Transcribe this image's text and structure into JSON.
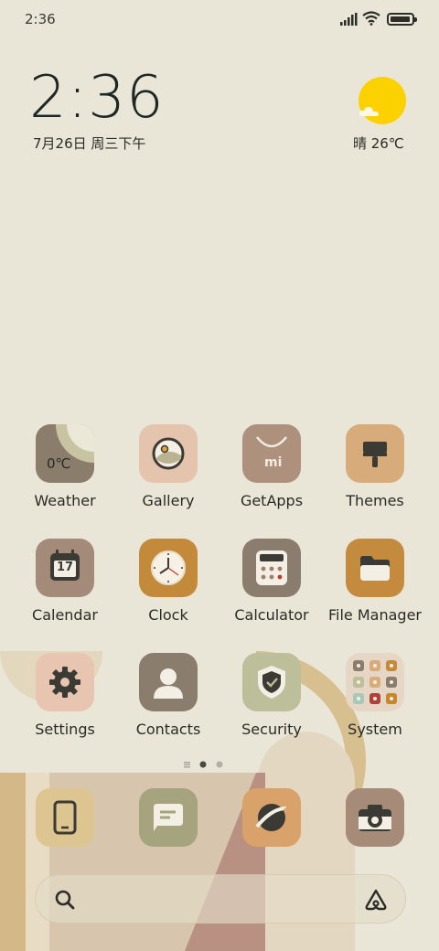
{
  "status_bar": {
    "time": "2:36",
    "battery_level": 0.95
  },
  "clock_widget": {
    "time": "2:36",
    "date": "7月26日 周三下午"
  },
  "weather_widget": {
    "text": "晴 26℃",
    "icon": "sunny-cloud-icon"
  },
  "apps": [
    {
      "name": "Weather",
      "icon": "weather-icon",
      "color": "#8a7d6b",
      "temp": "0℃"
    },
    {
      "name": "Gallery",
      "icon": "gallery-icon",
      "color": "#e4c4ad"
    },
    {
      "name": "GetApps",
      "icon": "getapps-icon",
      "color": "#ad917c",
      "mi": "mi"
    },
    {
      "name": "Themes",
      "icon": "themes-icon",
      "color": "#d8ab7a"
    },
    {
      "name": "Calendar",
      "icon": "calendar-icon",
      "color": "#a48a78",
      "day": "17"
    },
    {
      "name": "Clock",
      "icon": "clock-icon",
      "color": "#c38a3c"
    },
    {
      "name": "Calculator",
      "icon": "calculator-icon",
      "color": "#8a7d6e"
    },
    {
      "name": "File Manager",
      "icon": "folder-icon",
      "color": "#c48b3f"
    },
    {
      "name": "Settings",
      "icon": "gear-icon",
      "color": "#e7c5b0"
    },
    {
      "name": "Contacts",
      "icon": "contacts-icon",
      "color": "#8a7d6e"
    },
    {
      "name": "Security",
      "icon": "shield-icon",
      "color": "#bcbf99"
    },
    {
      "name": "System",
      "icon": "folder-grid-icon",
      "color": "#e6d6c6"
    }
  ],
  "dock": [
    {
      "name": "Phone",
      "icon": "phone-icon",
      "color": "#dcc590"
    },
    {
      "name": "Messages",
      "icon": "message-icon",
      "color": "#a6a47e"
    },
    {
      "name": "Browser",
      "icon": "browser-icon",
      "color": "#d8a26a"
    },
    {
      "name": "Camera",
      "icon": "camera-icon",
      "color": "#a68b79"
    }
  ],
  "search_bar": {
    "placeholder": ""
  }
}
